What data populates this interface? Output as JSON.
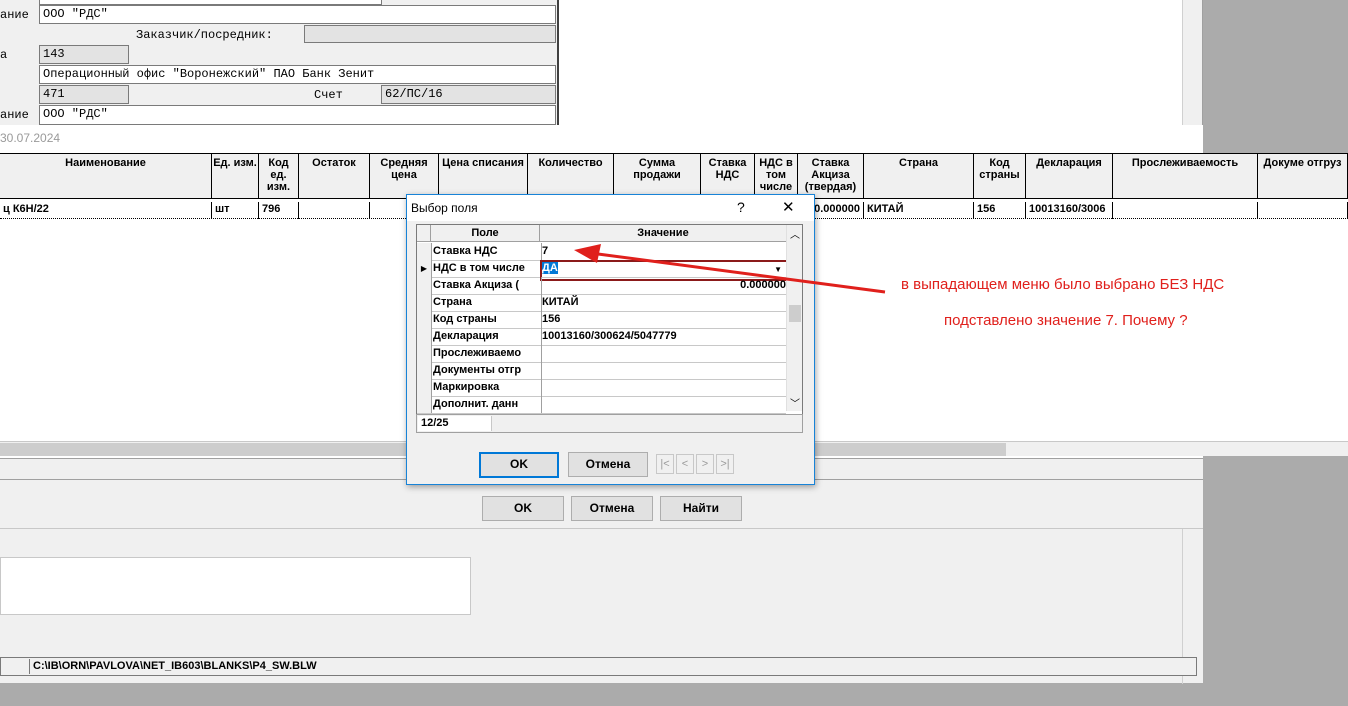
{
  "top_form": {
    "label_1": "ание",
    "value_1": "ООО \"РДС\"",
    "customer_label": "Заказчик/посредник:",
    "label_2": "а",
    "value_2": "143",
    "bank_name": "Операционный офис \"Воронежский\" ПАО Банк Зенит",
    "value_3": "471",
    "account_label": "Счет",
    "account_value": "62/ПС/16",
    "label_4": "ание",
    "value_4": "ООО \"РДС\""
  },
  "date_text": "30.07.2024",
  "grid": {
    "headers": [
      "Наименование",
      "Ед. изм.",
      "Код ед. изм.",
      "Остаток",
      "Средняя цена",
      "Цена списания",
      "Количество",
      "Сумма продажи",
      "Ставка НДС",
      "НДС в том числе",
      "Ставка Акциза (твердая)",
      "Страна",
      "Код страны",
      "Декларация",
      "Прослеживаемость",
      "Докуме отгруз"
    ],
    "row": [
      "ц К6Н/22",
      "шт",
      "796",
      "",
      "",
      "",
      "",
      "",
      "",
      "",
      "0.000000",
      "КИТАЙ",
      "156",
      "10013160/3006",
      "",
      ""
    ]
  },
  "dialog": {
    "title": "Выбор поля",
    "help": "?",
    "close": "✕",
    "col_field": "Поле",
    "col_value": "Значение",
    "rows": [
      {
        "field": "Ставка НДС",
        "value": "7"
      },
      {
        "field": "НДС в том числе",
        "value": "ДА"
      },
      {
        "field": "Ставка Акциза (",
        "value": "0.000000"
      },
      {
        "field": "Страна",
        "value": "КИТАЙ"
      },
      {
        "field": "Код страны",
        "value": "156"
      },
      {
        "field": "Декларация",
        "value": "10013160/300624/5047779"
      },
      {
        "field": "Прослеживаемо",
        "value": ""
      },
      {
        "field": "Документы отгр",
        "value": ""
      },
      {
        "field": "Маркировка",
        "value": ""
      },
      {
        "field": "Дополнит. данн",
        "value": ""
      }
    ],
    "counter": "12/25",
    "ok": "OK",
    "cancel": "Отмена",
    "nav": [
      "|<",
      "<",
      ">",
      ">|"
    ]
  },
  "main_buttons": {
    "ok": "OK",
    "cancel": "Отмена",
    "find": "Найти"
  },
  "status_path": "C:\\IB\\ORN\\PAVLOVA\\NET_IB603\\BLANKS\\P4_SW.BLW",
  "annotation": {
    "line1": "в выпадающем меню было выбрано БЕЗ НДС",
    "line2": "подставлено значение 7. Почему ?",
    "color": "#e0201c"
  }
}
